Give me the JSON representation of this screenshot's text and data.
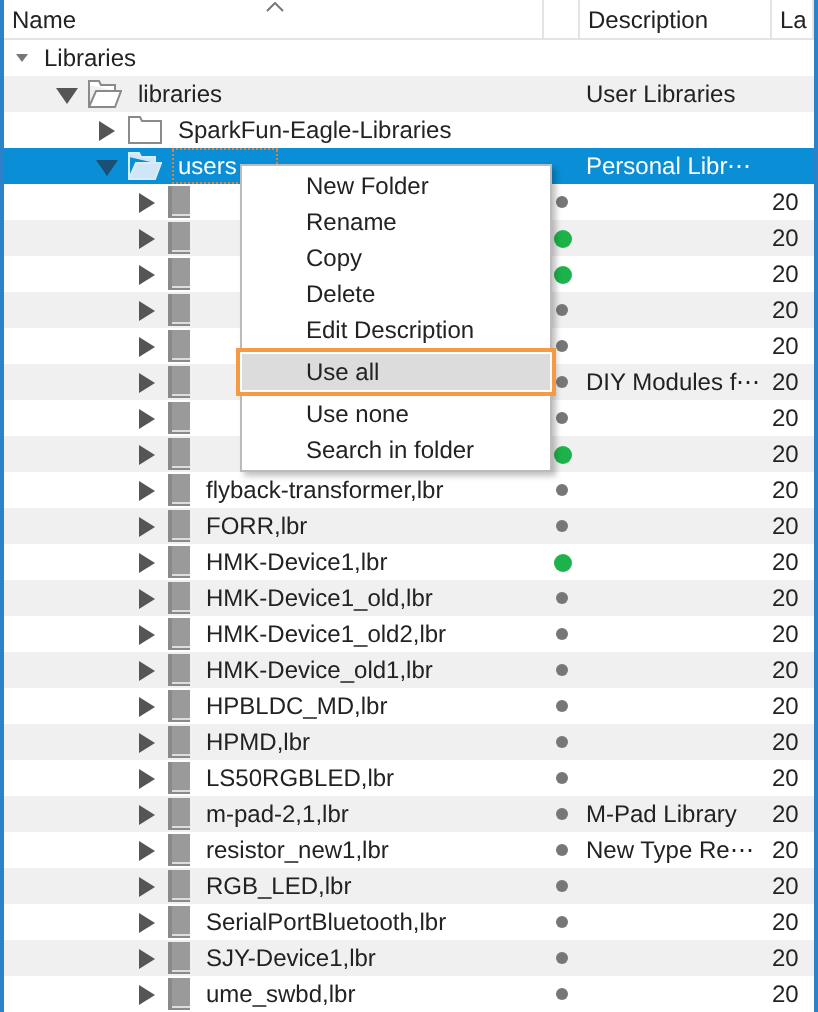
{
  "columns": [
    {
      "label": "Name",
      "sorted": true
    },
    {},
    {
      "label": "Description"
    },
    {
      "label": "La"
    }
  ],
  "tree": [
    {
      "label": "Libraries",
      "kind": "root",
      "expanded": true,
      "selected": false,
      "children": [
        {
          "label": "libraries",
          "kind": "folder",
          "description": "User Libraries",
          "expanded": true,
          "selected": false,
          "children": [
            {
              "label": "SparkFun-Eagle-Libraries",
              "kind": "folder",
              "expanded": false,
              "selected": false
            },
            {
              "label": "users",
              "kind": "folder",
              "description": "Personal Libr⋯",
              "expanded": true,
              "selected": true,
              "children": [
                {
                  "kind": "file",
                  "loaded": false,
                  "date": "20",
                  "expanded": false,
                  "selected": false
                },
                {
                  "kind": "file",
                  "loaded": true,
                  "date": "20",
                  "expanded": false,
                  "selected": false
                },
                {
                  "kind": "file",
                  "loaded": true,
                  "date": "20",
                  "expanded": false,
                  "selected": false
                },
                {
                  "kind": "file",
                  "loaded": false,
                  "date": "20",
                  "expanded": false,
                  "selected": false
                },
                {
                  "kind": "file",
                  "loaded": false,
                  "date": "20",
                  "expanded": false,
                  "selected": false
                },
                {
                  "kind": "file",
                  "loaded": false,
                  "description": "DIY Modules f⋯",
                  "date": "20",
                  "expanded": false,
                  "selected": false
                },
                {
                  "kind": "file",
                  "loaded": false,
                  "date": "20",
                  "expanded": false,
                  "selected": false
                },
                {
                  "kind": "file",
                  "loaded": true,
                  "date": "20",
                  "expanded": false,
                  "selected": false
                },
                {
                  "label": "flyback-transformer,lbr",
                  "kind": "file",
                  "loaded": false,
                  "date": "20",
                  "expanded": false,
                  "selected": false
                },
                {
                  "label": "FORR,lbr",
                  "kind": "file",
                  "loaded": false,
                  "date": "20",
                  "expanded": false,
                  "selected": false
                },
                {
                  "label": "HMK-Device1,lbr",
                  "kind": "file",
                  "loaded": true,
                  "date": "20",
                  "expanded": false,
                  "selected": false
                },
                {
                  "label": "HMK-Device1_old,lbr",
                  "kind": "file",
                  "loaded": false,
                  "date": "20",
                  "expanded": false,
                  "selected": false
                },
                {
                  "label": "HMK-Device1_old2,lbr",
                  "kind": "file",
                  "loaded": false,
                  "date": "20",
                  "expanded": false,
                  "selected": false
                },
                {
                  "label": "HMK-Device_old1,lbr",
                  "kind": "file",
                  "loaded": false,
                  "date": "20",
                  "expanded": false,
                  "selected": false
                },
                {
                  "label": "HPBLDC_MD,lbr",
                  "kind": "file",
                  "loaded": false,
                  "date": "20",
                  "expanded": false,
                  "selected": false
                },
                {
                  "label": "HPMD,lbr",
                  "kind": "file",
                  "loaded": false,
                  "date": "20",
                  "expanded": false,
                  "selected": false
                },
                {
                  "label": "LS50RGBLED,lbr",
                  "kind": "file",
                  "loaded": false,
                  "date": "20",
                  "expanded": false,
                  "selected": false
                },
                {
                  "label": "m-pad-2,1,lbr",
                  "kind": "file",
                  "loaded": false,
                  "description": "M-Pad Library",
                  "date": "20",
                  "expanded": false,
                  "selected": false
                },
                {
                  "label": "resistor_new1,lbr",
                  "kind": "file",
                  "loaded": false,
                  "description": "New Type Re⋯",
                  "date": "20",
                  "expanded": false,
                  "selected": false
                },
                {
                  "label": "RGB_LED,lbr",
                  "kind": "file",
                  "loaded": false,
                  "date": "20",
                  "expanded": false,
                  "selected": false
                },
                {
                  "label": "SerialPortBluetooth,lbr",
                  "kind": "file",
                  "loaded": false,
                  "date": "20",
                  "expanded": false,
                  "selected": false
                },
                {
                  "label": "SJY-Device1,lbr",
                  "kind": "file",
                  "loaded": false,
                  "date": "20",
                  "expanded": false,
                  "selected": false
                },
                {
                  "label": "ume_swbd,lbr",
                  "kind": "file",
                  "loaded": false,
                  "date": "20",
                  "expanded": false,
                  "selected": false
                }
              ]
            }
          ]
        }
      ]
    }
  ],
  "context_menu": {
    "items": [
      {
        "label": "New Folder",
        "hovered": false,
        "highlighted": false
      },
      {
        "label": "Rename",
        "hovered": false,
        "highlighted": false
      },
      {
        "label": "Copy",
        "hovered": false,
        "highlighted": false
      },
      {
        "label": "Delete",
        "hovered": false,
        "highlighted": false
      },
      {
        "label": "Edit Description",
        "hovered": false,
        "highlighted": false
      },
      {
        "label": "Use all",
        "hovered": true,
        "highlighted": true
      },
      {
        "label": "Use none",
        "hovered": false,
        "highlighted": false
      },
      {
        "label": "Search in folder",
        "hovered": false,
        "highlighted": false
      }
    ]
  }
}
